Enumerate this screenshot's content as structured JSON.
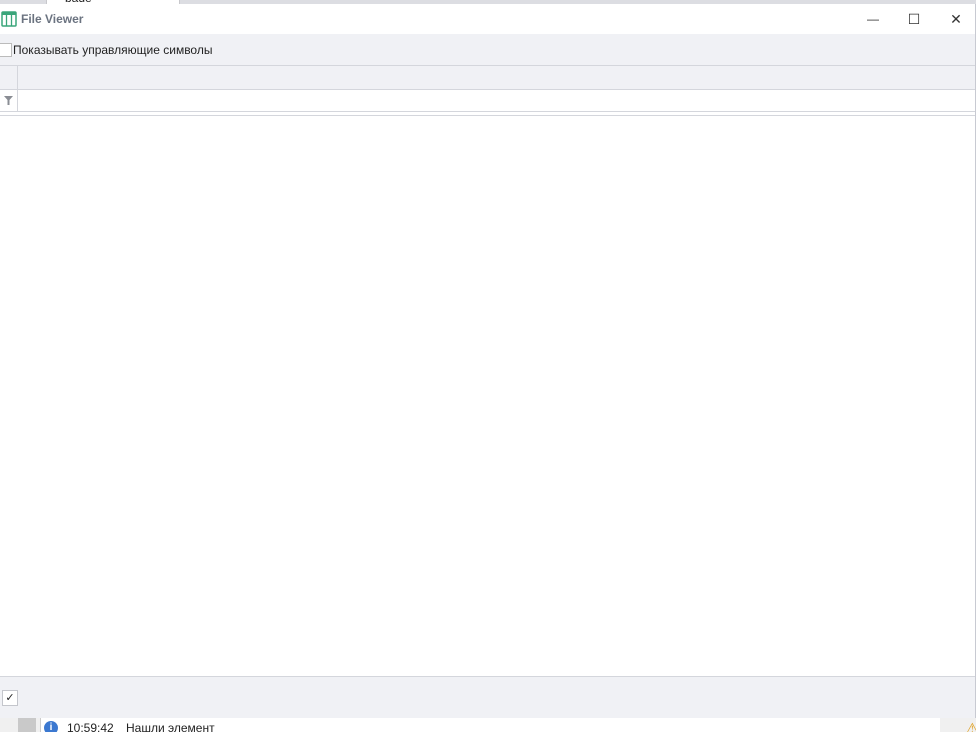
{
  "background": {
    "tab_label": "bade"
  },
  "window": {
    "title": "File Viewer",
    "minimize": "—",
    "maximize": "☐",
    "close": "✕"
  },
  "toolbar": {
    "show_control_chars_label": "Показывать управляющие символы",
    "show_control_chars_checked": false
  },
  "footer": {
    "ok_glyph": "✓"
  },
  "status": {
    "time": "10:59:42",
    "message": "Нашли элемент"
  }
}
